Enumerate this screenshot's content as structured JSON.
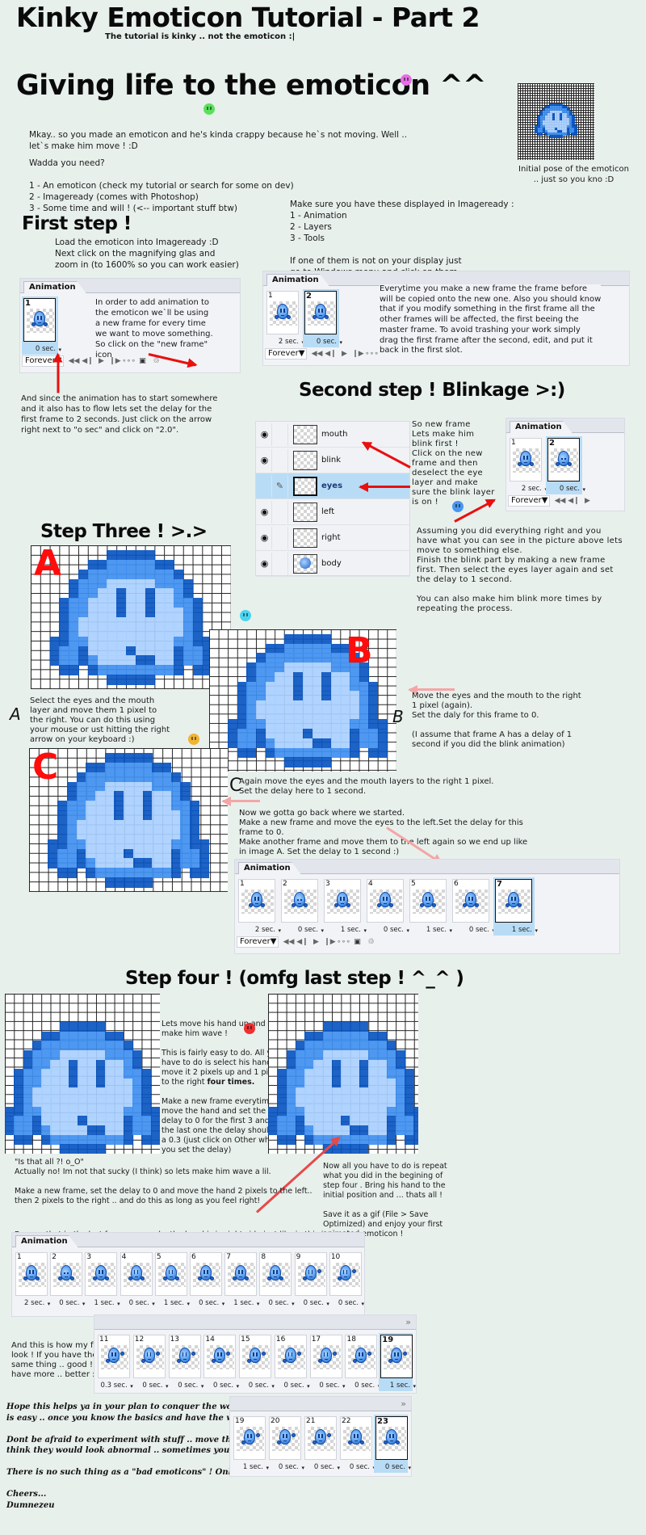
{
  "header": {
    "title": "Kinky Emoticon Tutorial - Part 2",
    "subtitle": "The tutorial is kinky .. not the emoticon :|",
    "section_title": "Giving life to the emoticon ^^"
  },
  "intro": {
    "paragraph": "Mkay.. so you made an emoticon and he's kinda crappy because he`s not moving. Well ..\nlet`s make him move ! :D",
    "need_heading": "Wadda you need?",
    "needs": [
      "1 - An emoticon (check my tutorial or search for some on dev)",
      "2 - Imageready (comes with Photoshop)",
      "3 - Some time and will ! (<-- important stuff btw)"
    ],
    "initial_pose_caption": "Initial pose of the emoticon\n.. just so you kno :D",
    "display_note": "Make sure you have these displayed in Imageready :\n1 - Animation\n2 - Layers\n3 - Tools\n\nIf one of them is not on your display just\ngo to Windows menu and click on them."
  },
  "step1": {
    "title": "First step !",
    "text": "Load the emoticon into Imageready :D\nNext click on the magnifying glas and\nzoom in (to 1600% so you can work easier)",
    "panel_text": "In order to add animation to\nthe emoticon we`ll be using\na new frame for every time\nwe want to move something.\nSo click on the \"new frame\"\nicon",
    "delay_note": "And since the animation has to start somewhere\nand it also has to flow lets set the delay for the\n first frame to 2 seconds. Just click on the arrow\nright next to \"o sec\" and click on \"2.0\".",
    "copy_note": "Everytime you make a new frame the frame before\nwill be copied onto the new one. Also you should know\nthat if you modify something in the first frame all the\nother frames will be affected, the first beeing the\nmaster frame. To avoid trashing your work simply\ndrag the first frame after the second, edit, and put it\nback in the first slot."
  },
  "panels": {
    "tab_label": "Animation",
    "loop_option": "Forever",
    "more_glyph": "»",
    "p1": {
      "frames": [
        {
          "num": "1",
          "delay": "0 sec.",
          "selected": true,
          "pose": "normal"
        }
      ]
    },
    "p2": {
      "frames": [
        {
          "num": "1",
          "delay": "2 sec.",
          "selected": false,
          "pose": "normal"
        },
        {
          "num": "2",
          "delay": "0 sec.",
          "selected": true,
          "pose": "normal"
        }
      ]
    },
    "p3": {
      "frames": [
        {
          "num": "1",
          "delay": "2 sec.",
          "selected": false,
          "pose": "normal"
        },
        {
          "num": "2",
          "delay": "0 sec.",
          "selected": true,
          "pose": "blink"
        }
      ]
    },
    "p4": {
      "frames": [
        {
          "num": "1",
          "delay": "2 sec.",
          "selected": false,
          "pose": "normal"
        },
        {
          "num": "2",
          "delay": "0 sec.",
          "selected": false,
          "pose": "blink"
        },
        {
          "num": "3",
          "delay": "1 sec.",
          "selected": false,
          "pose": "normal"
        },
        {
          "num": "4",
          "delay": "0 sec.",
          "selected": false,
          "pose": "normal"
        },
        {
          "num": "5",
          "delay": "1 sec.",
          "selected": false,
          "pose": "normal"
        },
        {
          "num": "6",
          "delay": "0 sec.",
          "selected": false,
          "pose": "normal"
        },
        {
          "num": "7",
          "delay": "1 sec.",
          "selected": true,
          "pose": "normal"
        }
      ]
    },
    "p5": {
      "frames": [
        {
          "num": "1",
          "delay": "2 sec.",
          "selected": false,
          "pose": "normal"
        },
        {
          "num": "2",
          "delay": "0 sec.",
          "selected": false,
          "pose": "blink"
        },
        {
          "num": "3",
          "delay": "1 sec.",
          "selected": false,
          "pose": "normal"
        },
        {
          "num": "4",
          "delay": "0 sec.",
          "selected": false,
          "pose": "normal"
        },
        {
          "num": "5",
          "delay": "1 sec.",
          "selected": false,
          "pose": "normal"
        },
        {
          "num": "6",
          "delay": "0 sec.",
          "selected": false,
          "pose": "normal"
        },
        {
          "num": "7",
          "delay": "1 sec.",
          "selected": false,
          "pose": "normal"
        },
        {
          "num": "8",
          "delay": "0 sec.",
          "selected": false,
          "pose": "normal"
        },
        {
          "num": "9",
          "delay": "0 sec.",
          "selected": false,
          "pose": "wave"
        },
        {
          "num": "10",
          "delay": "0 sec.",
          "selected": false,
          "pose": "wave"
        }
      ]
    },
    "p6": {
      "frames": [
        {
          "num": "11",
          "delay": "0.3 sec.",
          "selected": false,
          "pose": "wave"
        },
        {
          "num": "12",
          "delay": "0 sec.",
          "selected": false,
          "pose": "wave"
        },
        {
          "num": "13",
          "delay": "0 sec.",
          "selected": false,
          "pose": "wave"
        },
        {
          "num": "14",
          "delay": "0 sec.",
          "selected": false,
          "pose": "wave"
        },
        {
          "num": "15",
          "delay": "0 sec.",
          "selected": false,
          "pose": "wave"
        },
        {
          "num": "16",
          "delay": "0 sec.",
          "selected": false,
          "pose": "wave"
        },
        {
          "num": "17",
          "delay": "0 sec.",
          "selected": false,
          "pose": "wave"
        },
        {
          "num": "18",
          "delay": "0 sec.",
          "selected": false,
          "pose": "wave"
        },
        {
          "num": "19",
          "delay": "1 sec.",
          "selected": true,
          "pose": "wave"
        }
      ]
    },
    "p7": {
      "frames": [
        {
          "num": "19",
          "delay": "1 sec.",
          "selected": false,
          "pose": "wave"
        },
        {
          "num": "20",
          "delay": "0 sec.",
          "selected": false,
          "pose": "wave"
        },
        {
          "num": "21",
          "delay": "0 sec.",
          "selected": false,
          "pose": "wave"
        },
        {
          "num": "22",
          "delay": "0 sec.",
          "selected": false,
          "pose": "normal"
        },
        {
          "num": "23",
          "delay": "0 sec.",
          "selected": true,
          "pose": "normal"
        }
      ]
    }
  },
  "step2": {
    "title": "Second step ! Blinkage >:)",
    "layers": [
      {
        "name": "mouth",
        "visible": true,
        "selected": false
      },
      {
        "name": "blink",
        "visible": true,
        "selected": false
      },
      {
        "name": "eyes",
        "visible": false,
        "selected": true
      },
      {
        "name": "left",
        "visible": true,
        "selected": false
      },
      {
        "name": "right",
        "visible": true,
        "selected": false
      },
      {
        "name": "body",
        "visible": true,
        "selected": false
      }
    ],
    "text1": "So new frame\nLets make him\nblink first !\nClick on the new\nframe and then\ndeselect the eye\nlayer and make\nsure the blink layer\nis on !",
    "text2": "Assuming you did everything right and you\nhave what you can see in the picture above lets\nmove to something else.\nFinish the blink part by making a new frame\nfirst. Then select the eyes layer again and set\nthe delay to 1 second.\n\nYou can also make him blink more times by\nrepeating the process."
  },
  "step3": {
    "title": "Step Three ! >.>",
    "labels": {
      "a": "A",
      "b": "B",
      "c": "C"
    },
    "text_a": "Select the eyes and the mouth\nlayer and move them 1 pixel to\nthe right. You can do this using\nyour mouse or ust hitting the right\narrow on your keyboard  :)",
    "text_b": "Move the eyes and the mouth to the right\n1 pixel (again).\nSet the daly for this frame to 0.\n\n(I assume that frame A has a delay of 1\nsecond if you did the blink animation)",
    "text_c": "Again move the eyes and the mouth layers to the right 1 pixel.\nSet the delay here to 1 second.",
    "text_back": "Now we gotta go back where we started.\nMake a new frame and move the eyes to the left.Set the delay for this\nframe to 0.\nMake another frame and move them to the left again so we end up like\nin image A. Set the delay to 1 second :)"
  },
  "step4": {
    "title": "Step four ! (omfg last step ! ^_^ )",
    "text1_a": "Lets move his hand up and\nmake him wave !\n\nThis is fairly easy to do. All you\nhave to do is select his hand and\nmove it 2 pixels up and 1 pixel\nto the right ",
    "text1_bold": "four times.",
    "text1_b": "Make a new frame everytime you\nmove the hand and set the\ndelay to 0 for the first 3 and for\nthe last one the delay should be\na 0.3 (just click on Other when\nyou set the delay)",
    "text2": "\"Is that all ?! o_O\"\nActually no! Im not that sucky (I think) so lets make him wave a lil.\n\nMake a new frame, set the delay to 0 and move the hand 2 pixels to the left..\nthen 2 pixels to the right .. and do this as long as you feel right!",
    "text3_prefix": "Be sure that in the last frame you make the hand is in right side just like in ",
    "text3_link": "this image",
    "text_right": "Now all you have to do is repeat\nwhat you did in the begining of\nstep four . Bring his hand to the\ninitial position and ... thats all !\n\nSave it as a gif (File > Save\nOptimized) and enjoy your first\nanimated emoticon !",
    "frames_note": "And this is how my frames\nlook ! If you have the\nsame thing .. good ! If you\nhave more .. better :)"
  },
  "outro": {
    "text": "Hope this helps ya in your plan to conquer the world. Animating emoticons\nis easy .. once you know the basics and have the will to do it.\n\nDont be afraid to experiment with stuff .. move the eyes in a place you\nthink they would look abnormal .. sometimes you get incredible results.\n\nThere is no such thing as a \"bad emoticons\" ! Only unloved ones !\n\nCheers...\nDumnezeu"
  },
  "colors": {
    "background": "#e8f0ec",
    "selection": "#b8dcf5",
    "red_label": "#ff0c0c",
    "emoticon_dark": "#0a55c0",
    "emoticon_mid": "#3f8ff0",
    "emoticon_light": "#a9d0ff"
  },
  "icons": {
    "control_buttons": [
      "first-frame-icon",
      "prev-frame-icon",
      "play-icon",
      "next-frame-icon",
      "tween-icon",
      "new-frame-icon",
      "trash-icon"
    ]
  }
}
